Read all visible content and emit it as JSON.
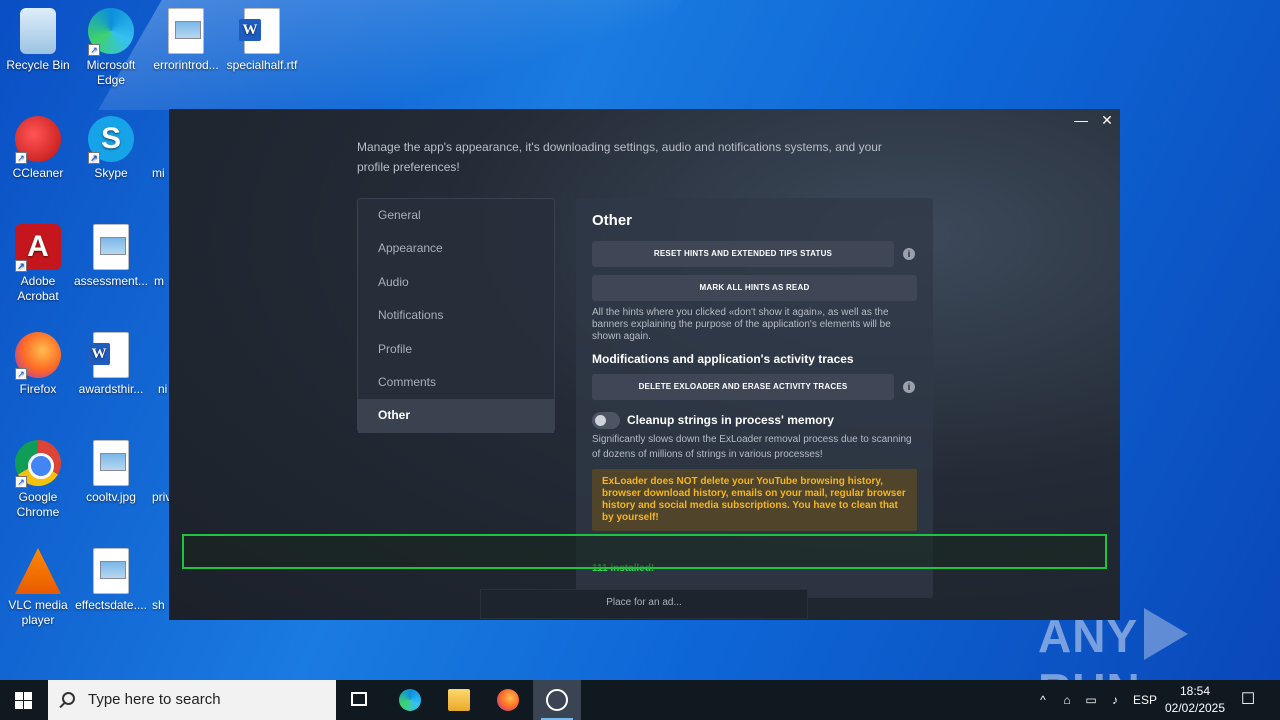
{
  "desktop": {
    "icons": [
      {
        "label": "Recycle Bin"
      },
      {
        "label": "Microsoft Edge"
      },
      {
        "label": "errorintrod..."
      },
      {
        "label": "specialhalf.rtf"
      },
      {
        "label": "CCleaner"
      },
      {
        "label": "Skype"
      },
      {
        "label": "Adobe Acrobat"
      },
      {
        "label": "assessment..."
      },
      {
        "label": "Firefox"
      },
      {
        "label": "awardsthir..."
      },
      {
        "label": "Google Chrome"
      },
      {
        "label": "cooltv.jpg"
      },
      {
        "label": "VLC media player"
      },
      {
        "label": "effectsdate...."
      }
    ],
    "partial_labels": [
      "mi",
      "m",
      "ni",
      "priv",
      "sh"
    ]
  },
  "app": {
    "intro": "Manage the app's appearance, it's downloading settings, audio and notifications systems, and your profile preferences!",
    "menu": [
      "General",
      "Appearance",
      "Audio",
      "Notifications",
      "Profile",
      "Comments",
      "Other"
    ],
    "active_menu": "Other",
    "panel": {
      "title": "Other",
      "reset_hints_btn": "RESET HINTS AND EXTENDED TIPS STATUS",
      "mark_read_btn": "MARK ALL HINTS AS READ",
      "hints_note": "All the hints where you clicked «don't show it again», as well as the banners explaining the purpose of the application's elements will be shown again.",
      "section_title": "Modifications and application's activity traces",
      "delete_btn": "DELETE EXLOADER AND ERASE ACTIVITY TRACES",
      "toggle_label": "Cleanup strings in process' memory",
      "toggle_note": "Significantly slows down the ExLoader removal process due to scanning of dozens of millions of strings in various processes!",
      "warning": "ExLoader does NOT delete your YouTube browsing history, browser download history, emails on your mail, regular browser history and social media subscriptions. You have to clean that by yourself!",
      "green_status": "111 installed!"
    },
    "ad_text": "Place for an ad...",
    "info_glyph": "i",
    "minimize_glyph": "—",
    "close_glyph": "✕"
  },
  "watermark": {
    "left": "ANY",
    "right": "RUN"
  },
  "taskbar": {
    "search_placeholder": "Type here to search",
    "language": "ESP",
    "time": "18:54",
    "date": "02/02/2025",
    "tray_chevron": "^",
    "notification_glyph": "☐"
  }
}
